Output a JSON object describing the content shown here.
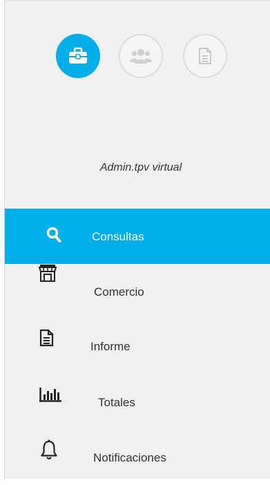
{
  "header": {
    "steps": [
      {
        "name": "briefcase-icon",
        "state": "active"
      },
      {
        "name": "users-icon",
        "state": "inactive"
      },
      {
        "name": "document-icon",
        "state": "inactive"
      }
    ]
  },
  "profile": {
    "role": "Admin.tpv virtual"
  },
  "menu": {
    "items": [
      {
        "label": "Consultas",
        "icon": "search-icon",
        "active": true
      },
      {
        "label": "Comercio",
        "icon": "store-icon",
        "active": false
      },
      {
        "label": "Informe",
        "icon": "report-icon",
        "active": false
      },
      {
        "label": "Totales",
        "icon": "bar-chart-icon",
        "active": false
      },
      {
        "label": "Notificaciones",
        "icon": "bell-icon",
        "active": false
      }
    ]
  },
  "colors": {
    "accent": "#00aeea",
    "panel_background": "#f0f0f0",
    "text": "#333333"
  }
}
